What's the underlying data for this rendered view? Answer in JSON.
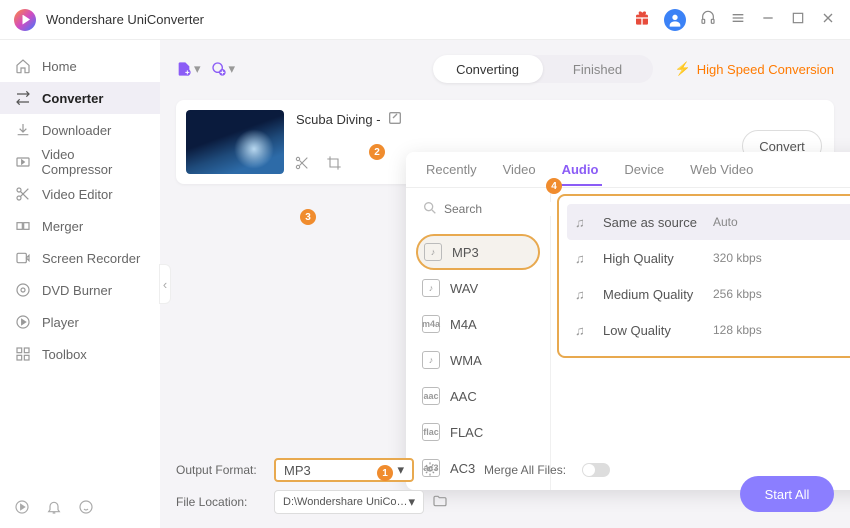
{
  "app": {
    "title": "Wondershare UniConverter"
  },
  "sidebar": {
    "items": [
      {
        "label": "Home"
      },
      {
        "label": "Converter"
      },
      {
        "label": "Downloader"
      },
      {
        "label": "Video Compressor"
      },
      {
        "label": "Video Editor"
      },
      {
        "label": "Merger"
      },
      {
        "label": "Screen Recorder"
      },
      {
        "label": "DVD Burner"
      },
      {
        "label": "Player"
      },
      {
        "label": "Toolbox"
      }
    ]
  },
  "toolbar": {
    "segments": {
      "a": "Converting",
      "b": "Finished"
    },
    "hsc": "High Speed Conversion"
  },
  "card": {
    "title": "Scuba Diving -",
    "convert": "Convert"
  },
  "popup": {
    "tabs": {
      "recently": "Recently",
      "video": "Video",
      "audio": "Audio",
      "device": "Device",
      "web": "Web Video"
    },
    "search_placeholder": "Search",
    "formats": [
      {
        "label": "MP3"
      },
      {
        "label": "WAV"
      },
      {
        "label": "M4A"
      },
      {
        "label": "WMA"
      },
      {
        "label": "AAC"
      },
      {
        "label": "FLAC"
      },
      {
        "label": "AC3"
      }
    ],
    "qualities": [
      {
        "name": "Same as source",
        "val": "Auto"
      },
      {
        "name": "High Quality",
        "val": "320 kbps"
      },
      {
        "name": "Medium Quality",
        "val": "256 kbps"
      },
      {
        "name": "Low Quality",
        "val": "128 kbps"
      }
    ]
  },
  "bottom": {
    "output_label": "Output Format:",
    "output_value": "MP3",
    "merge_label": "Merge All Files:",
    "loc_label": "File Location:",
    "loc_value": "D:\\Wondershare UniConverter",
    "start": "Start All"
  },
  "steps": {
    "1": "1",
    "2": "2",
    "3": "3",
    "4": "4"
  }
}
